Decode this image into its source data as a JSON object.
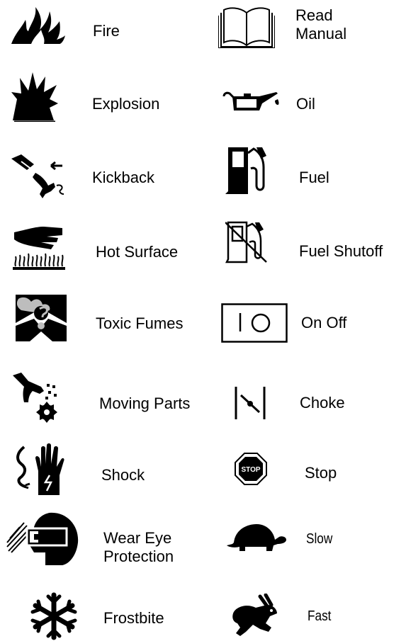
{
  "left_column": [
    {
      "label": "Fire",
      "icon": "fire-icon"
    },
    {
      "label": "Explosion",
      "icon": "explosion-icon"
    },
    {
      "label": "Kickback",
      "icon": "kickback-icon"
    },
    {
      "label": "Hot Surface",
      "icon": "hot-surface-icon"
    },
    {
      "label": "Toxic Fumes",
      "icon": "toxic-fumes-icon"
    },
    {
      "label": "Moving Parts",
      "icon": "moving-parts-icon"
    },
    {
      "label": "Shock",
      "icon": "shock-icon"
    },
    {
      "label_lines": [
        "Wear Eye",
        "Protection"
      ],
      "icon": "eye-protection-icon"
    },
    {
      "label": "Frostbite",
      "icon": "frostbite-icon"
    }
  ],
  "right_column": [
    {
      "label_lines": [
        "Read",
        "Manual"
      ],
      "icon": "read-manual-icon"
    },
    {
      "label": "Oil",
      "icon": "oil-can-icon"
    },
    {
      "label": "Fuel",
      "icon": "fuel-pump-icon"
    },
    {
      "label": "Fuel Shutoff",
      "icon": "fuel-shutoff-icon"
    },
    {
      "label": "On Off",
      "icon": "on-off-switch-icon"
    },
    {
      "label": "Choke",
      "icon": "choke-icon"
    },
    {
      "label": "Stop",
      "icon": "stop-sign-icon",
      "icon_text": "STOP"
    },
    {
      "label": "Slow",
      "icon": "turtle-icon"
    },
    {
      "label": "Fast",
      "icon": "rabbit-icon"
    }
  ]
}
